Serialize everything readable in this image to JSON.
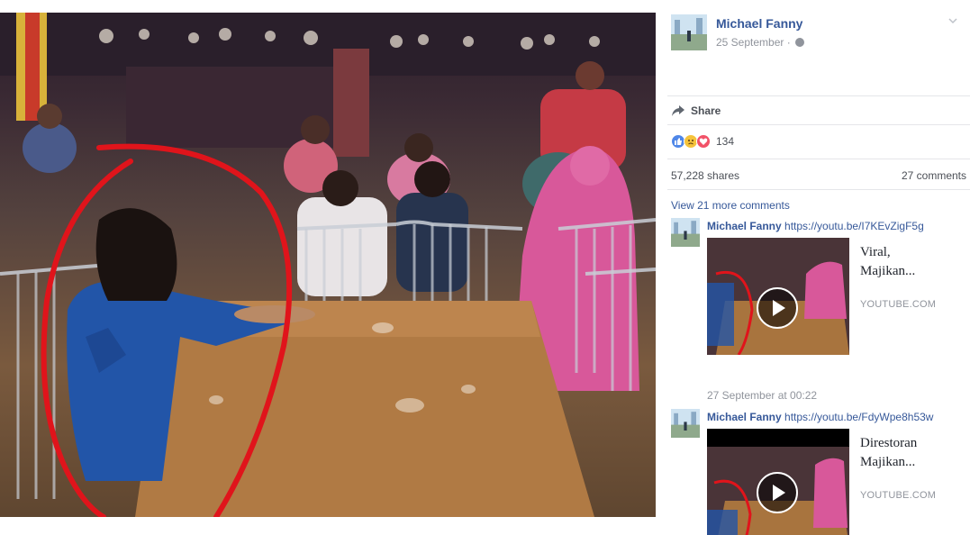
{
  "post": {
    "author": "Michael Fanny",
    "date": "25 September",
    "date_separator": "·",
    "share_label": "Share",
    "reaction_count": "134",
    "shares": "57,228 shares",
    "comments_count": "27 comments",
    "view_more_comments": "View 21 more comments"
  },
  "comments": [
    {
      "author": "Michael Fanny",
      "link": "https://youtu.be/I7KEvZigF5g",
      "preview_title_line1": "Viral,",
      "preview_title_line2": "Majikan...",
      "preview_source": "YOUTUBE.COM",
      "timestamp": "27 September at 00:22"
    },
    {
      "author": "Michael Fanny",
      "link": "https://youtu.be/FdyWpe8h53w",
      "preview_title_line1": "Direstoran",
      "preview_title_line2": "Majikan...",
      "preview_source": "YOUTUBE.COM"
    }
  ],
  "icons": {
    "share": "share-arrow-icon",
    "like": "like-reaction-icon",
    "sad": "sad-reaction-icon",
    "love": "love-reaction-icon",
    "globe": "globe-icon",
    "chevron": "chevron-down-icon",
    "play": "play-icon"
  },
  "colors": {
    "link": "#365899",
    "muted": "#90949c",
    "like": "#4f87e8",
    "sad": "#f5c33b",
    "love": "#f25268",
    "circle_annotation": "#e0141b"
  }
}
